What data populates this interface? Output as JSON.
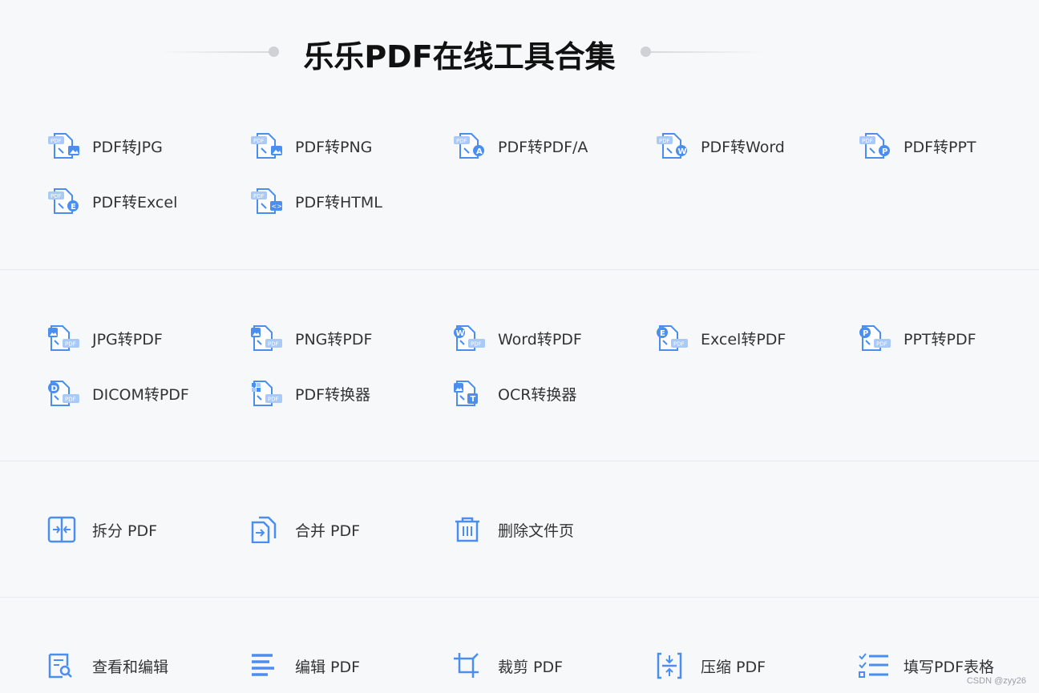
{
  "header": {
    "title": "乐乐PDF在线工具合集"
  },
  "sections": [
    {
      "name": "pdf-to-other",
      "tools": [
        {
          "label": "PDF转JPG",
          "icon": "pdf-to-image-icon"
        },
        {
          "label": "PDF转PNG",
          "icon": "pdf-to-image-icon"
        },
        {
          "label": "PDF转PDF/A",
          "icon": "pdf-to-pdfa-icon"
        },
        {
          "label": "PDF转Word",
          "icon": "pdf-to-word-icon"
        },
        {
          "label": "PDF转PPT",
          "icon": "pdf-to-ppt-icon"
        },
        {
          "label": "PDF转Excel",
          "icon": "pdf-to-excel-icon"
        },
        {
          "label": "PDF转HTML",
          "icon": "pdf-to-html-icon"
        }
      ]
    },
    {
      "name": "other-to-pdf",
      "tools": [
        {
          "label": "JPG转PDF",
          "icon": "image-to-pdf-icon"
        },
        {
          "label": "PNG转PDF",
          "icon": "image-to-pdf-icon"
        },
        {
          "label": "Word转PDF",
          "icon": "word-to-pdf-icon"
        },
        {
          "label": "Excel转PDF",
          "icon": "excel-to-pdf-icon"
        },
        {
          "label": "PPT转PDF",
          "icon": "ppt-to-pdf-icon"
        },
        {
          "label": "DICOM转PDF",
          "icon": "dicom-to-pdf-icon"
        },
        {
          "label": "PDF转换器",
          "icon": "pdf-converter-icon"
        },
        {
          "label": "OCR转换器",
          "icon": "ocr-converter-icon"
        }
      ]
    },
    {
      "name": "page-tools",
      "tools": [
        {
          "label": "拆分 PDF",
          "icon": "split-icon"
        },
        {
          "label": "合并 PDF",
          "icon": "merge-icon"
        },
        {
          "label": "删除文件页",
          "icon": "trash-icon"
        }
      ]
    },
    {
      "name": "edit-tools",
      "tools": [
        {
          "label": "查看和编辑",
          "icon": "view-edit-icon"
        },
        {
          "label": "编辑 PDF",
          "icon": "edit-lines-icon"
        },
        {
          "label": "裁剪 PDF",
          "icon": "crop-icon"
        },
        {
          "label": "压缩 PDF",
          "icon": "compress-icon"
        },
        {
          "label": "填写PDF表格",
          "icon": "checklist-icon"
        }
      ]
    }
  ],
  "colors": {
    "accent": "#4a8ef0",
    "accent_light": "#a9c9f7",
    "text": "#333333"
  },
  "watermark": "CSDN @zyy26"
}
